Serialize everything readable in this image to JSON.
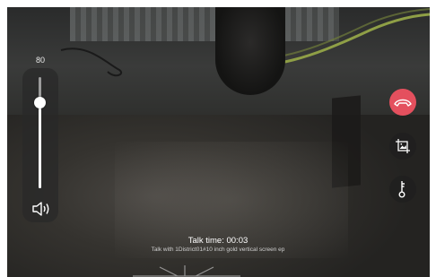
{
  "volume": {
    "value": "80",
    "level_fraction": 0.8,
    "icon": "speaker-icon"
  },
  "call": {
    "talk_time_label": "Talk time:",
    "talk_time_value": "00:03",
    "talk_with_text": "Talk with 1District01#10 inch gold vertical screen ep"
  },
  "actions": [
    {
      "name": "hangup",
      "icon": "phone-hangup-icon",
      "color": "#e4505e"
    },
    {
      "name": "snapshot",
      "icon": "image-crop-icon"
    },
    {
      "name": "unlock",
      "icon": "key-icon"
    }
  ],
  "colors": {
    "accent": "#e4505e",
    "text": "#ffffff"
  }
}
